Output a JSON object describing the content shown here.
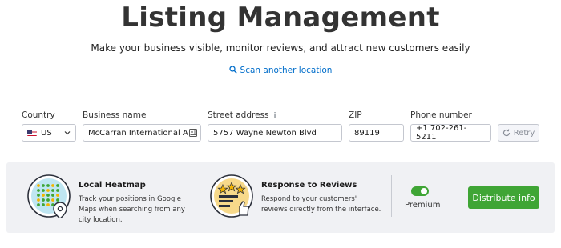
{
  "header": {
    "title": "Listing Management",
    "subtitle": "Make your business visible, monitor reviews, and attract new customers easily",
    "scan_link": "Scan another location"
  },
  "form": {
    "country": {
      "label": "Country",
      "value": "US"
    },
    "business_name": {
      "label": "Business name",
      "value": "McCarran International Airport"
    },
    "street_address": {
      "label": "Street address",
      "info": "i",
      "value": "5757 Wayne Newton Blvd"
    },
    "zip": {
      "label": "ZIP",
      "value": "89119"
    },
    "phone": {
      "label": "Phone number",
      "value": "+1 702-261-5211"
    },
    "retry_label": "Retry"
  },
  "promo": {
    "features": [
      {
        "title": "Local Heatmap",
        "description": "Track your positions in Google Maps when searching from any city location."
      },
      {
        "title": "Response to Reviews",
        "description": "Respond to your customers' reviews directly from the interface."
      }
    ],
    "premium_label": "Premium",
    "premium_enabled": true,
    "distribute_label": "Distribute info"
  },
  "colors": {
    "accent_green": "#3fa535",
    "link_blue": "#006dca",
    "panel_bg": "#f0f1f4"
  }
}
